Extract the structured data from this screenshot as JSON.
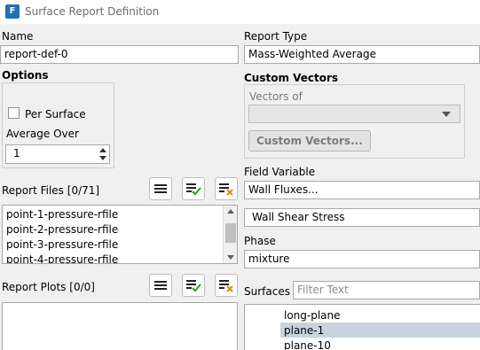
{
  "window": {
    "title": "Surface Report Definition",
    "app_icon": "F"
  },
  "name": {
    "label": "Name",
    "value": "report-def-0"
  },
  "options": {
    "heading": "Options",
    "per_surface_label": "Per Surface",
    "per_surface_checked": false,
    "average_over_label": "Average Over",
    "average_over_value": "1"
  },
  "report_type": {
    "label": "Report Type",
    "value": "Mass-Weighted Average"
  },
  "custom_vectors": {
    "heading": "Custom Vectors",
    "vectors_of_label": "Vectors of",
    "vectors_of_value": "",
    "button_label": "Custom Vectors..."
  },
  "field_variable": {
    "label": "Field Variable",
    "category": "Wall Fluxes...",
    "variable": "Wall Shear Stress"
  },
  "phase": {
    "label": "Phase",
    "value": "mixture"
  },
  "report_files": {
    "label": "Report Files",
    "count": "[0/71]",
    "items": [
      "point-1-pressure-rfile",
      "point-2-pressure-rfile",
      "point-3-pressure-rfile",
      "point-4-pressure-rfile"
    ]
  },
  "report_plots": {
    "label": "Report Plots",
    "count": "[0/0]"
  },
  "surfaces": {
    "label": "Surfaces",
    "filter_placeholder": "Filter Text",
    "items": [
      "long-plane",
      "plane-1",
      "plane-10"
    ],
    "selected_index": 1
  },
  "colors": {
    "accent": "#1f6fb5",
    "selection": "#c9d3e0",
    "check_green": "#2e9d2e",
    "cross_orange": "#e08a1e"
  }
}
